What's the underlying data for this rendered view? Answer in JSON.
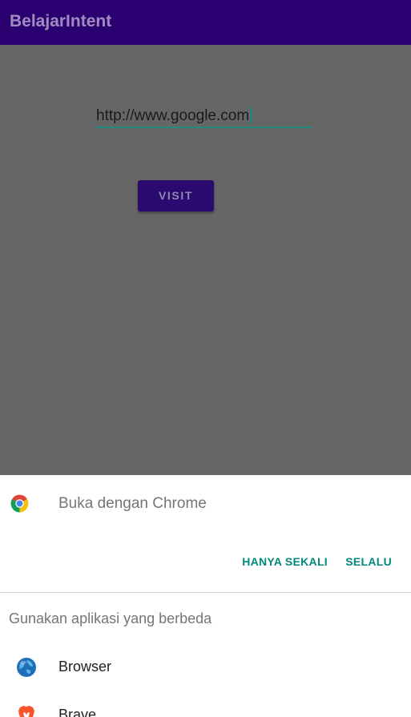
{
  "appbar": {
    "title": "BelajarIntent"
  },
  "form": {
    "url_value": "http://www.google.com",
    "visit_label": "VISIT"
  },
  "chooser": {
    "open_with": "Buka dengan Chrome",
    "just_once": "HANYA SEKALI",
    "always": "SELALU",
    "use_other": "Gunakan aplikasi yang berbeda",
    "apps": [
      {
        "name": "Browser",
        "icon": "globe-icon"
      },
      {
        "name": "Brave",
        "icon": "brave-lion-icon"
      }
    ]
  },
  "colors": {
    "appbar": "#2b0070",
    "accent": "#00897b",
    "button": "#2a0a6e",
    "scrim": "#666666"
  }
}
